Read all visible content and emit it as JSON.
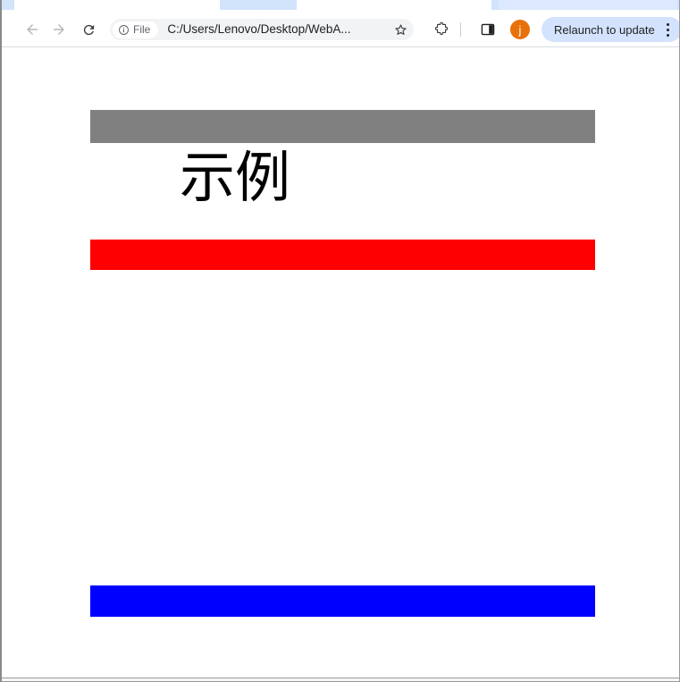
{
  "browser": {
    "tabs": [
      {
        "state": "active",
        "label": ""
      },
      {
        "state": "active",
        "label": ""
      },
      {
        "state": "inactive",
        "label": ""
      }
    ],
    "navigation": {
      "back_icon": "arrow-left-icon",
      "back_tooltip": "Back",
      "forward_icon": "arrow-right-icon",
      "forward_tooltip": "Forward",
      "reload_icon": "reload-icon",
      "reload_tooltip": "Reload this page"
    },
    "omnibox": {
      "scheme_chip_icon": "info-circle-icon",
      "scheme_chip_label": "File",
      "url": "C:/Users/Lenovo/Desktop/WebA...",
      "placeholder": "Search Google or type a URL",
      "bookmark_icon": "star-icon",
      "bookmark_tooltip": "Bookmark this tab"
    },
    "actions": {
      "extensions_icon": "puzzle-piece-icon",
      "extensions_tooltip": "Extensions",
      "sidepanel_icon": "side-panel-icon",
      "sidepanel_tooltip": "Show side panel",
      "avatar_initial": "j",
      "avatar_tooltip": "Profile",
      "relaunch_label": "Relaunch to update",
      "menu_icon": "three-dot-menu-icon",
      "menu_tooltip": "Customize and control Google Chrome"
    },
    "colors": {
      "tabstrip_bg": "#d2e3fc",
      "toolbar_bg": "#ffffff",
      "omnibox_bg": "#f1f3f4",
      "avatar_bg": "#e8710a",
      "relaunch_bg": "#d3e3fd"
    }
  },
  "page": {
    "heading": "示例",
    "bars": [
      {
        "name": "grey-bar",
        "color": "#808080"
      },
      {
        "name": "red-bar",
        "color": "#ff0000"
      },
      {
        "name": "blue-bar",
        "color": "#0000ff"
      }
    ]
  }
}
